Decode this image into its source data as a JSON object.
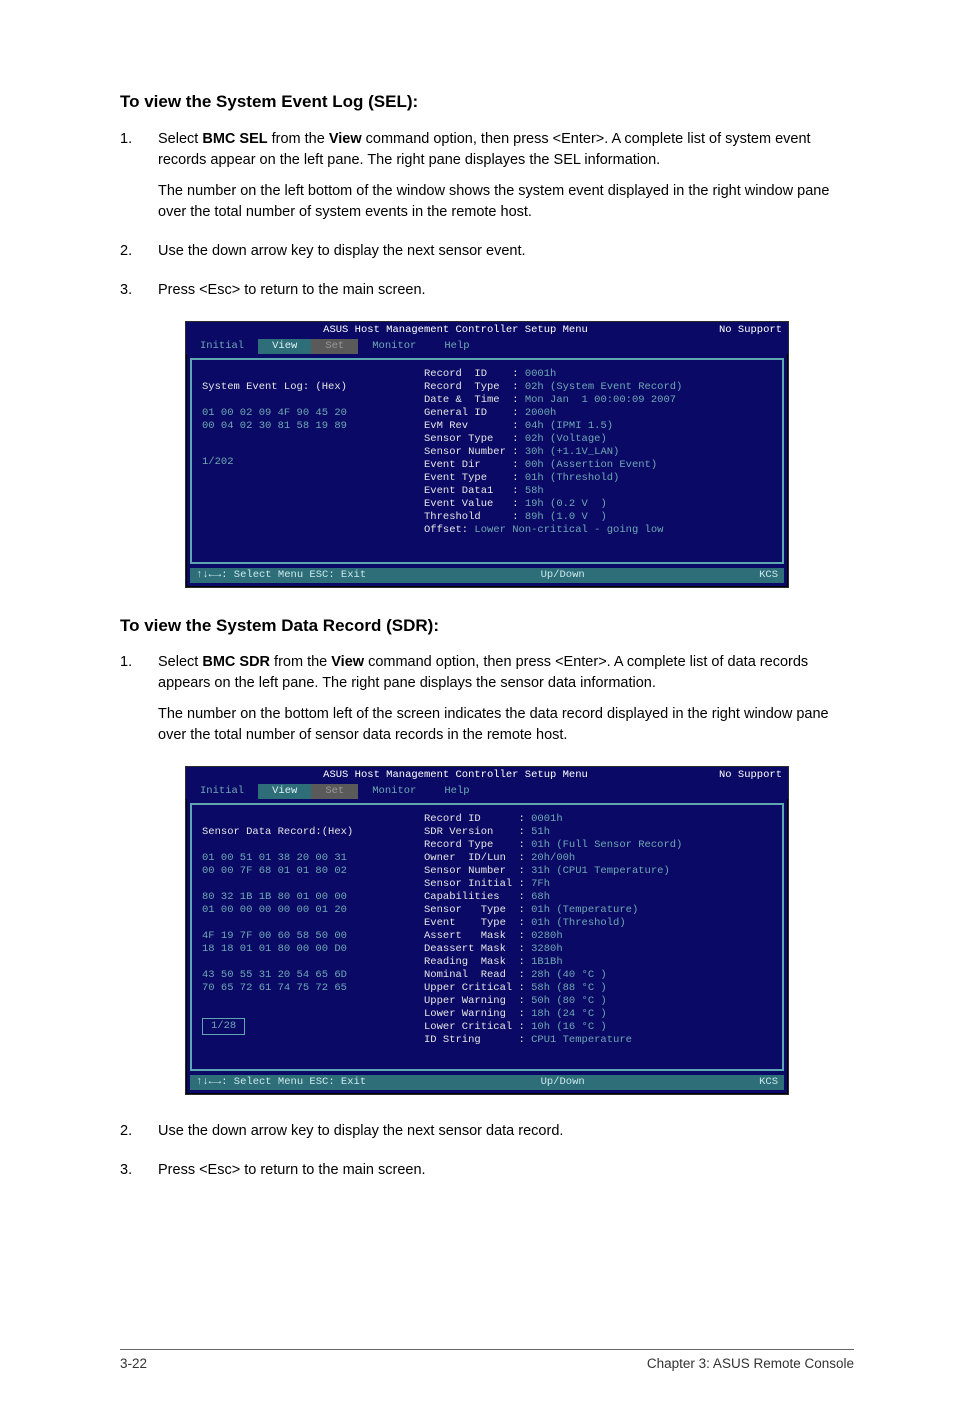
{
  "sel": {
    "heading": "To view the System Event Log (SEL):",
    "steps": [
      {
        "num": "1.",
        "p1a": "Select ",
        "p1b": "BMC SEL",
        "p1c": " from the ",
        "p1d": "View",
        "p1e": " command option, then press <Enter>. A complete list of system event records appear on the left pane. The right pane displayes the SEL information.",
        "p2": "The number on the left bottom of the window shows the system event displayed in the right window pane over the total number of system events in the remote host."
      },
      {
        "num": "2.",
        "text": "Use the down arrow key to display the next sensor event."
      },
      {
        "num": "3.",
        "text": "Press <Esc> to return to the main screen."
      }
    ]
  },
  "sdr": {
    "heading": "To view the System Data Record (SDR):",
    "steps": [
      {
        "num": "1.",
        "p1a": "Select ",
        "p1b": "BMC SDR",
        "p1c": " from the ",
        "p1d": "View",
        "p1e": " command option, then press <Enter>. A complete list of data records appears on the left pane. The right pane displays the sensor data information.",
        "p2": "The number on the bottom left of the screen indicates the data record displayed in the right window pane over the total number of sensor data records in the remote host."
      },
      {
        "num": "2.",
        "text": "Use the down arrow key to display the next sensor data record."
      },
      {
        "num": "3.",
        "text": "Press <Esc> to return to the main screen."
      }
    ]
  },
  "term_common": {
    "title": "ASUS Host Management Controller Setup Menu",
    "right_title": "No Support",
    "menus": {
      "initial": "Initial",
      "view": "View",
      "set": "Set",
      "monitor": "Monitor",
      "help": "Help"
    },
    "status_left": "↑↓←→: Select Menu   ESC: Exit",
    "status_mid": "Up/Down",
    "status_right": "KCS"
  },
  "term1": {
    "left_header": "System Event Log: (Hex)",
    "hex": "01 00 02 09 4F 90 45 20\n00 04 02 30 81 58 19 89",
    "pager": "1/202",
    "right_lines": [
      [
        "Record  ID    : ",
        "0001h"
      ],
      [
        "Record  Type  : ",
        "02h (System Event Record)"
      ],
      [
        "Date &  Time  : ",
        "Mon Jan  1 00:00:09 2007"
      ],
      [
        "General ID    : ",
        "2000h"
      ],
      [
        "EvM Rev       : ",
        "04h (IPMI 1.5)"
      ],
      [
        "Sensor Type   : ",
        "02h (Voltage)"
      ],
      [
        "Sensor Number : ",
        "30h (+1.1V_LAN)"
      ],
      [
        "Event Dir     : ",
        "00h (Assertion Event)"
      ],
      [
        "Event Type    : ",
        "01h (Threshold)"
      ],
      [
        "Event Data1   : ",
        "58h"
      ],
      [
        "Event Value   : ",
        "19h (0.2 V  )"
      ],
      [
        "Threshold     : ",
        "89h (1.0 V  )"
      ],
      [
        "Offset: ",
        "Lower Non-critical - going low"
      ]
    ]
  },
  "term2": {
    "left_header": "Sensor Data Record:(Hex)",
    "hex": "01 00 51 01 38 20 00 31\n00 00 7F 68 01 01 80 02\n\n80 32 1B 1B 80 01 00 00\n01 00 00 00 00 00 01 20\n\n4F 19 7F 00 60 58 50 00\n18 18 01 01 80 00 00 D0\n\n43 50 55 31 20 54 65 6D\n70 65 72 61 74 75 72 65",
    "pager": "1/28",
    "right_lines": [
      [
        "Record ID      : ",
        "0001h"
      ],
      [
        "SDR Version    : ",
        "51h"
      ],
      [
        "Record Type    : ",
        "01h (Full Sensor Record)"
      ],
      [
        "Owner  ID/Lun  : ",
        "20h/00h"
      ],
      [
        "Sensor Number  : ",
        "31h (CPU1 Temperature)"
      ],
      [
        "Sensor Initial : ",
        "7Fh"
      ],
      [
        "Capabilities   : ",
        "68h"
      ],
      [
        "Sensor   Type  : ",
        "01h (Temperature)"
      ],
      [
        "Event    Type  : ",
        "01h (Threshold)"
      ],
      [
        "Assert   Mask  : ",
        "0280h"
      ],
      [
        "Deassert Mask  : ",
        "3280h"
      ],
      [
        "Reading  Mask  : ",
        "1B1Bh"
      ],
      [
        "Nominal  Read  : ",
        "28h (40 °C )"
      ],
      [
        "Upper Critical : ",
        "58h (88 °C )"
      ],
      [
        "Upper Warning  : ",
        "50h (80 °C )"
      ],
      [
        "Lower Warning  : ",
        "18h (24 °C )"
      ],
      [
        "Lower Critical : ",
        "10h (16 °C )"
      ],
      [
        "ID String      : ",
        "CPU1 Temperature"
      ]
    ]
  },
  "footer": {
    "left": "3-22",
    "right": "Chapter 3: ASUS Remote Console"
  }
}
